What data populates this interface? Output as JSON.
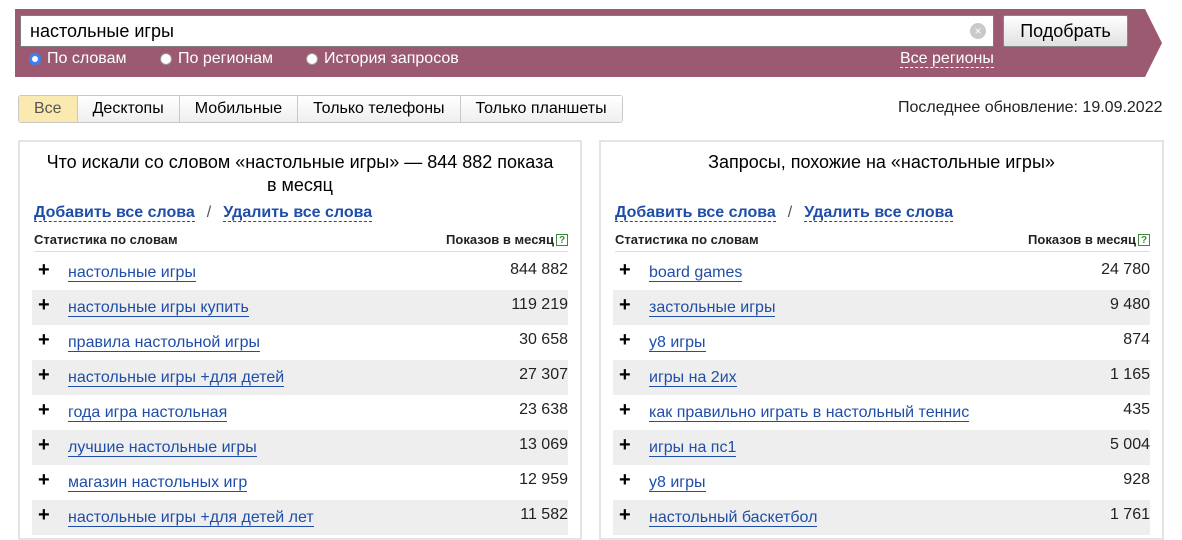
{
  "search": {
    "query": "настольные игры",
    "submit_label": "Подобрать",
    "modes": [
      {
        "label": "По словам",
        "checked": true
      },
      {
        "label": "По регионам",
        "checked": false
      },
      {
        "label": "История запросов",
        "checked": false
      }
    ],
    "regions_label": "Все регионы"
  },
  "tabs": [
    "Все",
    "Десктопы",
    "Мобильные",
    "Только телефоны",
    "Только планшеты"
  ],
  "active_tab": "Все",
  "last_update": "Последнее обновление: 19.09.2022",
  "left_panel": {
    "title": "Что искали со словом «настольные игры» — 844 882 показа в месяц",
    "add_all": "Добавить все слова",
    "separator": "/",
    "remove_all": "Удалить все слова",
    "col_words": "Статистика по словам",
    "col_shows": "Показов в месяц",
    "help": "?",
    "rows": [
      {
        "word": "настольные игры",
        "count": "844 882"
      },
      {
        "word": "настольные игры купить",
        "count": "119 219"
      },
      {
        "word": "правила настольной игры",
        "count": "30 658"
      },
      {
        "word": "настольные игры +для детей",
        "count": "27 307"
      },
      {
        "word": "года игра настольная",
        "count": "23 638"
      },
      {
        "word": "лучшие настольные игры",
        "count": "13 069"
      },
      {
        "word": "магазин настольных игр",
        "count": "12 959"
      },
      {
        "word": "настольные игры +для детей лет",
        "count": "11 582"
      }
    ]
  },
  "right_panel": {
    "title": "Запросы, похожие на «настольные игры»",
    "add_all": "Добавить все слова",
    "separator": "/",
    "remove_all": "Удалить все слова",
    "col_words": "Статистика по словам",
    "col_shows": "Показов в месяц",
    "help": "?",
    "rows": [
      {
        "word": "board games",
        "count": "24 780"
      },
      {
        "word": "застольные игры",
        "count": "9 480"
      },
      {
        "word": "у8 игры",
        "count": "874"
      },
      {
        "word": "игры на 2их",
        "count": "1 165"
      },
      {
        "word": "как правильно играть в настольный теннис",
        "count": "435"
      },
      {
        "word": "игры на пс1",
        "count": "5 004"
      },
      {
        "word": "у8 игры",
        "count": "928"
      },
      {
        "word": "настольный баскетбол",
        "count": "1 761"
      }
    ]
  },
  "icons": {
    "plus": "+",
    "clear": "×"
  }
}
